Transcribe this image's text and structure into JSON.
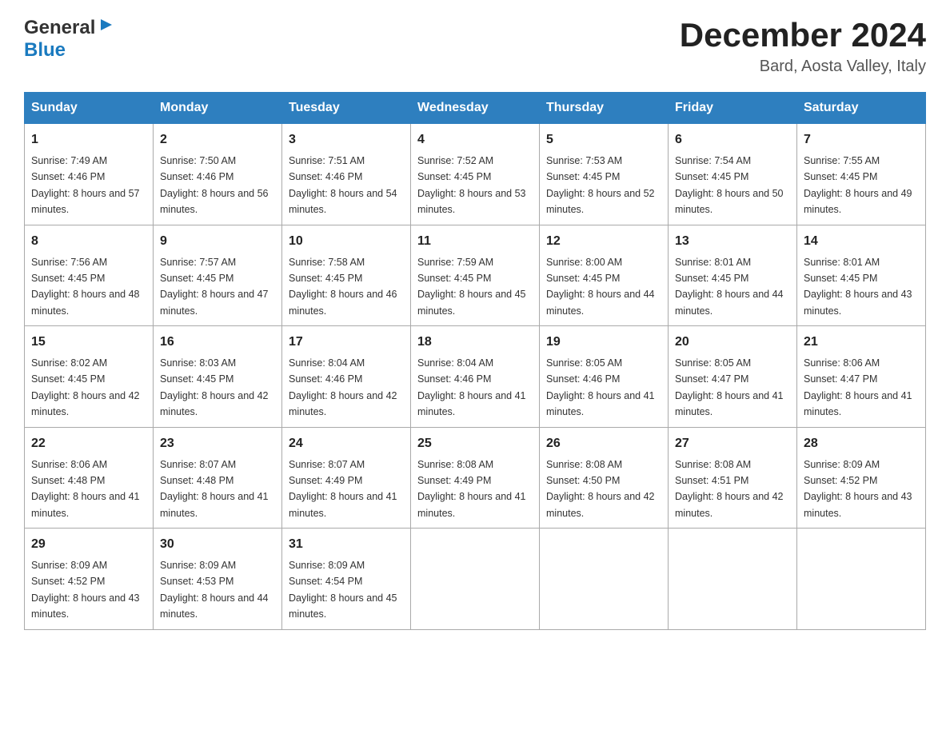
{
  "header": {
    "logo_general": "General",
    "logo_blue": "Blue",
    "title": "December 2024",
    "subtitle": "Bard, Aosta Valley, Italy"
  },
  "days_of_week": [
    "Sunday",
    "Monday",
    "Tuesday",
    "Wednesday",
    "Thursday",
    "Friday",
    "Saturday"
  ],
  "weeks": [
    [
      {
        "day": "1",
        "sunrise": "7:49 AM",
        "sunset": "4:46 PM",
        "daylight": "8 hours and 57 minutes."
      },
      {
        "day": "2",
        "sunrise": "7:50 AM",
        "sunset": "4:46 PM",
        "daylight": "8 hours and 56 minutes."
      },
      {
        "day": "3",
        "sunrise": "7:51 AM",
        "sunset": "4:46 PM",
        "daylight": "8 hours and 54 minutes."
      },
      {
        "day": "4",
        "sunrise": "7:52 AM",
        "sunset": "4:45 PM",
        "daylight": "8 hours and 53 minutes."
      },
      {
        "day": "5",
        "sunrise": "7:53 AM",
        "sunset": "4:45 PM",
        "daylight": "8 hours and 52 minutes."
      },
      {
        "day": "6",
        "sunrise": "7:54 AM",
        "sunset": "4:45 PM",
        "daylight": "8 hours and 50 minutes."
      },
      {
        "day": "7",
        "sunrise": "7:55 AM",
        "sunset": "4:45 PM",
        "daylight": "8 hours and 49 minutes."
      }
    ],
    [
      {
        "day": "8",
        "sunrise": "7:56 AM",
        "sunset": "4:45 PM",
        "daylight": "8 hours and 48 minutes."
      },
      {
        "day": "9",
        "sunrise": "7:57 AM",
        "sunset": "4:45 PM",
        "daylight": "8 hours and 47 minutes."
      },
      {
        "day": "10",
        "sunrise": "7:58 AM",
        "sunset": "4:45 PM",
        "daylight": "8 hours and 46 minutes."
      },
      {
        "day": "11",
        "sunrise": "7:59 AM",
        "sunset": "4:45 PM",
        "daylight": "8 hours and 45 minutes."
      },
      {
        "day": "12",
        "sunrise": "8:00 AM",
        "sunset": "4:45 PM",
        "daylight": "8 hours and 44 minutes."
      },
      {
        "day": "13",
        "sunrise": "8:01 AM",
        "sunset": "4:45 PM",
        "daylight": "8 hours and 44 minutes."
      },
      {
        "day": "14",
        "sunrise": "8:01 AM",
        "sunset": "4:45 PM",
        "daylight": "8 hours and 43 minutes."
      }
    ],
    [
      {
        "day": "15",
        "sunrise": "8:02 AM",
        "sunset": "4:45 PM",
        "daylight": "8 hours and 42 minutes."
      },
      {
        "day": "16",
        "sunrise": "8:03 AM",
        "sunset": "4:45 PM",
        "daylight": "8 hours and 42 minutes."
      },
      {
        "day": "17",
        "sunrise": "8:04 AM",
        "sunset": "4:46 PM",
        "daylight": "8 hours and 42 minutes."
      },
      {
        "day": "18",
        "sunrise": "8:04 AM",
        "sunset": "4:46 PM",
        "daylight": "8 hours and 41 minutes."
      },
      {
        "day": "19",
        "sunrise": "8:05 AM",
        "sunset": "4:46 PM",
        "daylight": "8 hours and 41 minutes."
      },
      {
        "day": "20",
        "sunrise": "8:05 AM",
        "sunset": "4:47 PM",
        "daylight": "8 hours and 41 minutes."
      },
      {
        "day": "21",
        "sunrise": "8:06 AM",
        "sunset": "4:47 PM",
        "daylight": "8 hours and 41 minutes."
      }
    ],
    [
      {
        "day": "22",
        "sunrise": "8:06 AM",
        "sunset": "4:48 PM",
        "daylight": "8 hours and 41 minutes."
      },
      {
        "day": "23",
        "sunrise": "8:07 AM",
        "sunset": "4:48 PM",
        "daylight": "8 hours and 41 minutes."
      },
      {
        "day": "24",
        "sunrise": "8:07 AM",
        "sunset": "4:49 PM",
        "daylight": "8 hours and 41 minutes."
      },
      {
        "day": "25",
        "sunrise": "8:08 AM",
        "sunset": "4:49 PM",
        "daylight": "8 hours and 41 minutes."
      },
      {
        "day": "26",
        "sunrise": "8:08 AM",
        "sunset": "4:50 PM",
        "daylight": "8 hours and 42 minutes."
      },
      {
        "day": "27",
        "sunrise": "8:08 AM",
        "sunset": "4:51 PM",
        "daylight": "8 hours and 42 minutes."
      },
      {
        "day": "28",
        "sunrise": "8:09 AM",
        "sunset": "4:52 PM",
        "daylight": "8 hours and 43 minutes."
      }
    ],
    [
      {
        "day": "29",
        "sunrise": "8:09 AM",
        "sunset": "4:52 PM",
        "daylight": "8 hours and 43 minutes."
      },
      {
        "day": "30",
        "sunrise": "8:09 AM",
        "sunset": "4:53 PM",
        "daylight": "8 hours and 44 minutes."
      },
      {
        "day": "31",
        "sunrise": "8:09 AM",
        "sunset": "4:54 PM",
        "daylight": "8 hours and 45 minutes."
      },
      null,
      null,
      null,
      null
    ]
  ]
}
